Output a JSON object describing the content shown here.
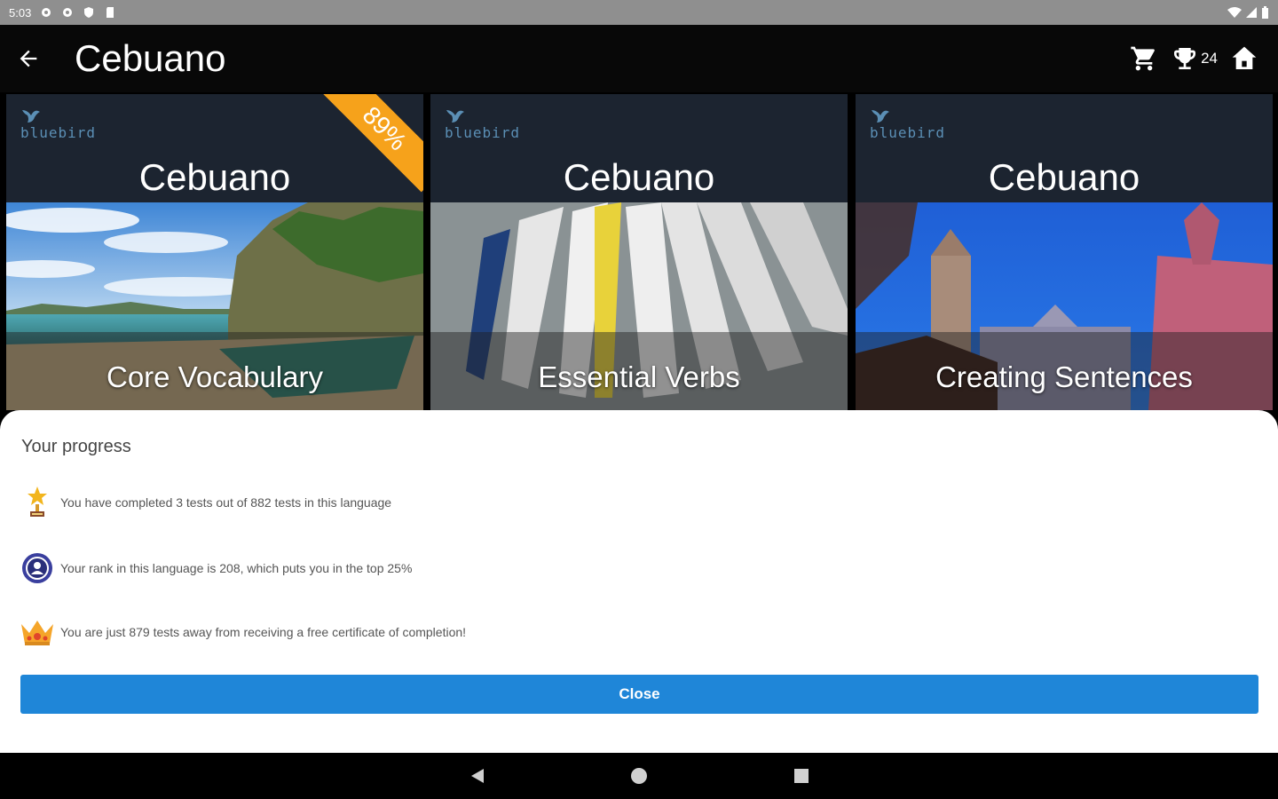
{
  "status_bar": {
    "time": "5:03",
    "left_icons": [
      "settings-icon",
      "settings-icon",
      "shield-icon",
      "sd-card-icon"
    ],
    "right_icons": [
      "wifi-icon",
      "signal-icon",
      "battery-icon"
    ]
  },
  "app_bar": {
    "title": "Cebuano",
    "trophy_count": "24",
    "icons": [
      "back-arrow-icon",
      "cart-icon",
      "trophy-icon",
      "home-icon"
    ]
  },
  "cards": [
    {
      "brand": "bluebird",
      "language": "Cebuano",
      "subtitle": "Core Vocabulary",
      "badge": "89%"
    },
    {
      "brand": "bluebird",
      "language": "Cebuano",
      "subtitle": "Essential Verbs"
    },
    {
      "brand": "bluebird",
      "language": "Cebuano",
      "subtitle": "Creating Sentences"
    }
  ],
  "progress": {
    "heading": "Your progress",
    "items": [
      {
        "icon": "trophy-star-icon",
        "text": "You have completed 3 tests out of 882 tests in this language"
      },
      {
        "icon": "rank-medal-icon",
        "text": "Your rank in this language is 208, which puts you in the top 25%"
      },
      {
        "icon": "crown-icon",
        "text": "You are just 879 tests away from receiving a free certificate of completion!"
      }
    ],
    "close_label": "Close"
  },
  "nav_bar": {
    "icons": [
      "nav-back-icon",
      "nav-home-icon",
      "nav-recents-icon"
    ]
  },
  "colors": {
    "accent": "#1f86d8",
    "ribbon": "#f6a21b",
    "card_header": "#1c2430"
  }
}
